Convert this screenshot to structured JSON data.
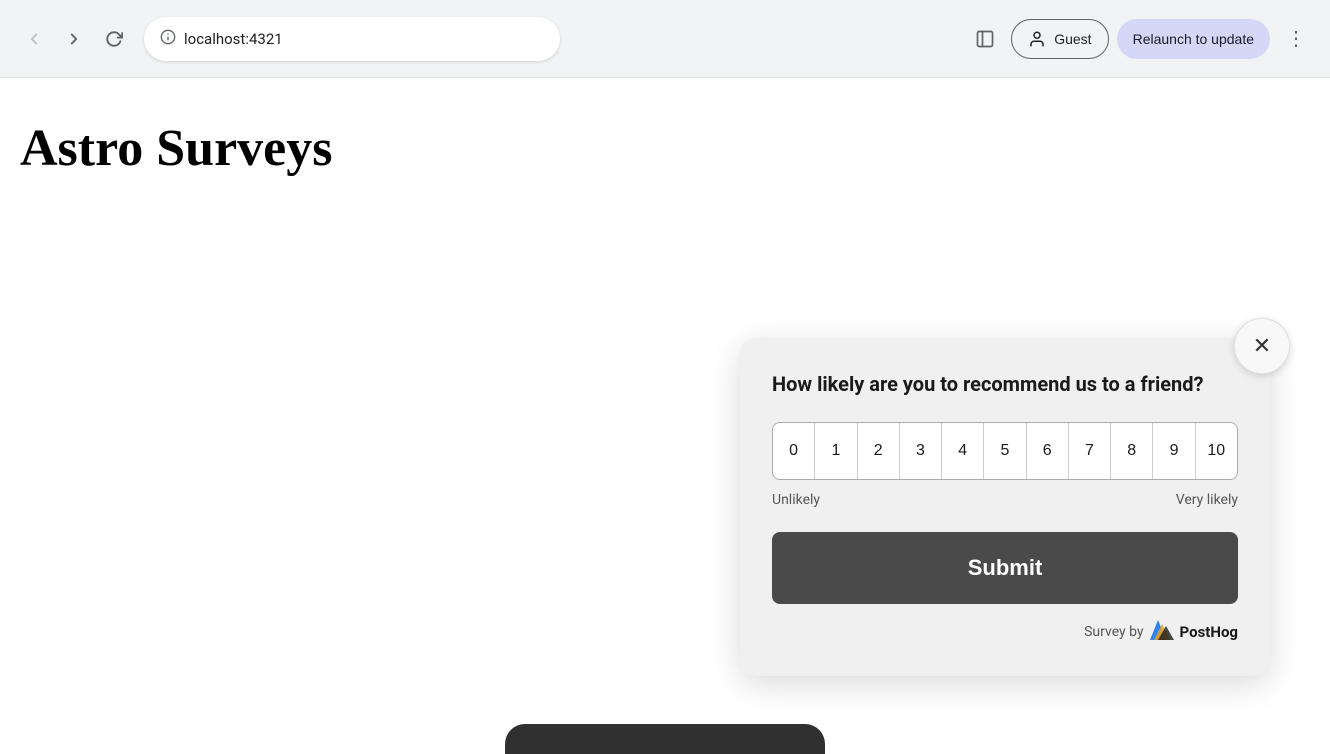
{
  "browser": {
    "url": "localhost:4321",
    "back_btn": "←",
    "forward_btn": "→",
    "reload_btn": "↺",
    "sidebar_icon": "▣",
    "guest_label": "Guest",
    "relaunch_label": "Relaunch to update",
    "more_icon": "⋮"
  },
  "page": {
    "title": "Astro Surveys"
  },
  "survey": {
    "question": "How likely are you to recommend us to a friend?",
    "close_icon": "✕",
    "rating_options": [
      "0",
      "1",
      "2",
      "3",
      "4",
      "5",
      "6",
      "7",
      "8",
      "9",
      "10"
    ],
    "label_low": "Unlikely",
    "label_high": "Very likely",
    "submit_label": "Submit",
    "footer_text": "Survey by",
    "posthog_label": "PostHog"
  }
}
